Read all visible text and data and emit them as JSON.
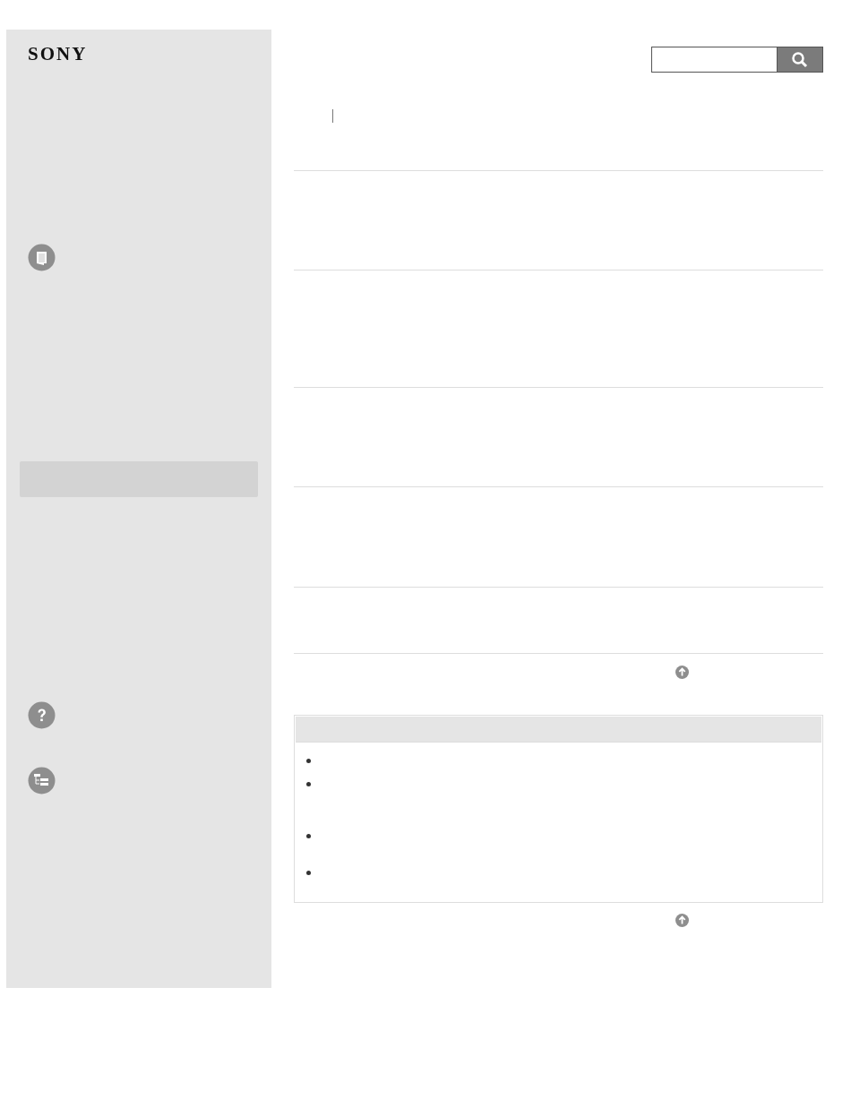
{
  "logo": {
    "text": "SONY"
  },
  "search": {
    "kind": "search"
  },
  "sidebar": {
    "items": [
      {
        "kind": "book"
      },
      {
        "kind": "highlight"
      },
      {
        "kind": "help"
      },
      {
        "kind": "tree"
      }
    ]
  },
  "sections": [
    {
      "kind": "row"
    },
    {
      "kind": "row"
    },
    {
      "kind": "row"
    },
    {
      "kind": "row"
    },
    {
      "kind": "row"
    }
  ],
  "notes": {
    "items": [
      {
        "kind": "bullet"
      },
      {
        "kind": "bullet"
      },
      {
        "kind": "bullet"
      },
      {
        "kind": "bullet"
      }
    ]
  }
}
